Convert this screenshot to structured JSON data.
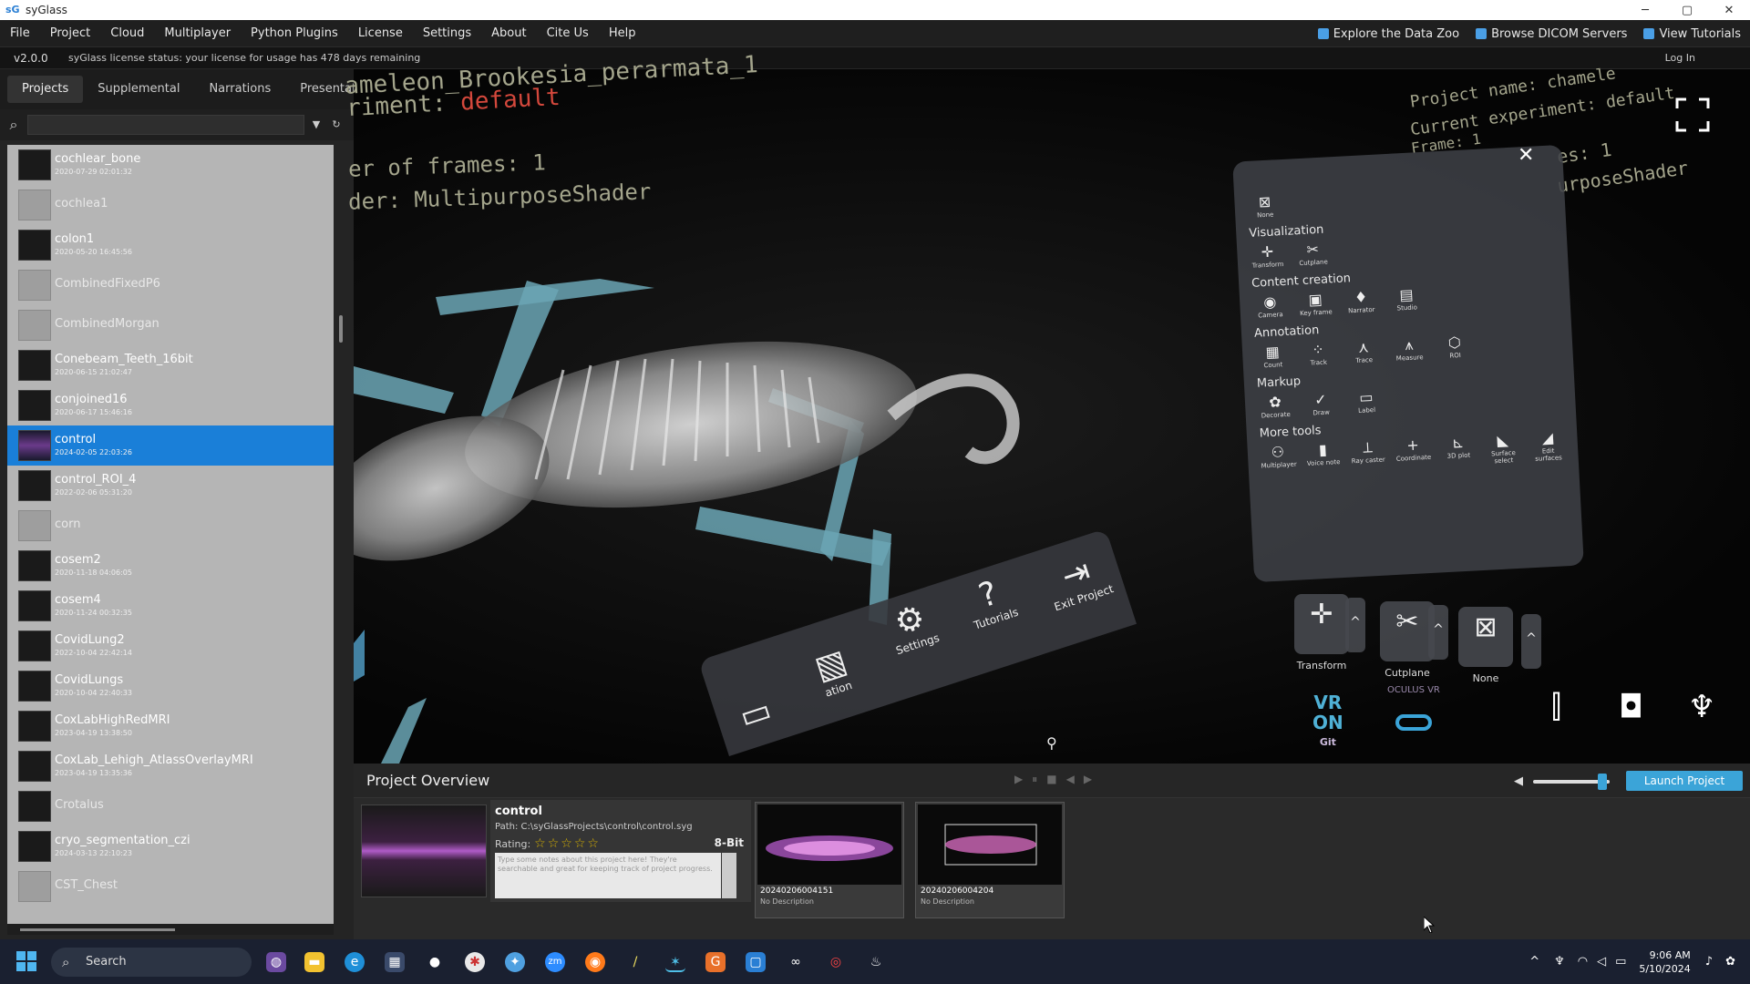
{
  "window": {
    "title": "syGlass",
    "logo": "sG",
    "minimize": "─",
    "maximize": "▢",
    "close": "✕"
  },
  "menu": {
    "items": [
      "File",
      "Project",
      "Cloud",
      "Multiplayer",
      "Python Plugins",
      "License",
      "Settings",
      "About",
      "Cite Us",
      "Help"
    ],
    "right": [
      "Explore the Data Zoo",
      "Browse DICOM Servers",
      "View Tutorials"
    ]
  },
  "status": {
    "version": "v2.0.0",
    "license": "syGlass license status: your license for usage has 478 days remaining",
    "login": "Log In"
  },
  "tabs": [
    "Projects",
    "Supplemental",
    "Narrations",
    "Presentations"
  ],
  "search": {
    "value": ""
  },
  "projects": [
    {
      "name": "cochlear_bone",
      "date": "2020-07-29 02:01:32",
      "dim": false
    },
    {
      "name": "cochlea1",
      "date": "",
      "dim": true
    },
    {
      "name": "colon1",
      "date": "2020-05-20 16:45:56",
      "dim": false
    },
    {
      "name": "CombinedFixedP6",
      "date": "",
      "dim": true
    },
    {
      "name": "CombinedMorgan",
      "date": "",
      "dim": true
    },
    {
      "name": "Conebeam_Teeth_16bit",
      "date": "2020-06-15 21:02:47",
      "dim": false
    },
    {
      "name": "conjoined16",
      "date": "2020-06-17 15:46:16",
      "dim": false
    },
    {
      "name": "control",
      "date": "2024-02-05 22:03:26",
      "dim": false,
      "selected": true
    },
    {
      "name": "control_ROI_4",
      "date": "2022-02-06 05:31:20",
      "dim": false
    },
    {
      "name": "corn",
      "date": "",
      "dim": true
    },
    {
      "name": "cosem2",
      "date": "2020-11-18 04:06:05",
      "dim": false
    },
    {
      "name": "cosem4",
      "date": "2020-11-24 00:32:35",
      "dim": false
    },
    {
      "name": "CovidLung2",
      "date": "2022-10-04 22:42:14",
      "dim": false
    },
    {
      "name": "CovidLungs",
      "date": "2020-10-04 22:40:33",
      "dim": false
    },
    {
      "name": "CoxLabHighRedMRI",
      "date": "2023-04-19 13:38:50",
      "dim": false
    },
    {
      "name": "CoxLab_Lehigh_AtlassOverlayMRI",
      "date": "2023-04-19 13:35:36",
      "dim": false
    },
    {
      "name": "Crotalus",
      "date": "",
      "dim": false
    },
    {
      "name": "cryo_segmentation_czi",
      "date": "2024-03-13 22:10:23",
      "dim": false
    },
    {
      "name": "CST_Chest",
      "date": "",
      "dim": true
    }
  ],
  "viewport": {
    "overlay_left": [
      "ameleon_Brookesia_perarmata_1",
      "riment: ",
      "er of frames: 1",
      "der: MultipurposeShader"
    ],
    "overlay_left_value": "default",
    "overlay_right": [
      "Project name: chamele",
      "Current experiment: ",
      "Frame: 1",
      "es: 1",
      "urposeShader"
    ],
    "overlay_right_value": "default"
  },
  "toolpanel": {
    "none": "None",
    "sections": [
      {
        "title": "Visualization",
        "tools": [
          {
            "icon": "✛",
            "label": "Transform"
          },
          {
            "icon": "✂",
            "label": "Cutplane"
          }
        ]
      },
      {
        "title": "Content creation",
        "tools": [
          {
            "icon": "◉",
            "label": "Camera"
          },
          {
            "icon": "▣",
            "label": "Key frame"
          },
          {
            "icon": "♦",
            "label": "Narrator"
          },
          {
            "icon": "▤",
            "label": "Studio"
          }
        ]
      },
      {
        "title": "Annotation",
        "tools": [
          {
            "icon": "▦",
            "label": "Count"
          },
          {
            "icon": "⁘",
            "label": "Track"
          },
          {
            "icon": "⋏",
            "label": "Trace"
          },
          {
            "icon": "⩚",
            "label": "Measure"
          },
          {
            "icon": "⬡",
            "label": "ROI"
          }
        ]
      },
      {
        "title": "Markup",
        "tools": [
          {
            "icon": "✿",
            "label": "Decorate"
          },
          {
            "icon": "✓",
            "label": "Draw"
          },
          {
            "icon": "▭",
            "label": "Label"
          }
        ]
      },
      {
        "title": "More tools",
        "tools": [
          {
            "icon": "⚇",
            "label": "Multiplayer"
          },
          {
            "icon": "▮",
            "label": "Voice note"
          },
          {
            "icon": "⟂",
            "label": "Ray caster"
          },
          {
            "icon": "+",
            "label": "Coordinate"
          },
          {
            "icon": "⊾",
            "label": "3D plot"
          },
          {
            "icon": "◣",
            "label": "Surface select"
          },
          {
            "icon": "◢",
            "label": "Edit surfaces"
          }
        ]
      }
    ]
  },
  "dock": [
    {
      "icon": "▭",
      "label": ""
    },
    {
      "icon": "▧",
      "label": "ation"
    },
    {
      "icon": "⚙",
      "label": "Settings"
    },
    {
      "icon": "?",
      "label": "Tutorials"
    },
    {
      "icon": "⇥",
      "label": "Exit Project"
    }
  ],
  "controls": [
    {
      "icon": "✛",
      "label": "Transform"
    },
    {
      "icon": "✂",
      "label": "Cutplane"
    },
    {
      "icon": "⊠",
      "label": "None"
    }
  ],
  "vr": {
    "line1": "VR",
    "line2": "ON",
    "sub": "Git",
    "oculus": "OCULUS VR"
  },
  "overview": {
    "title": "Project Overview",
    "media": [
      "▶",
      "⏸",
      "■",
      "◀",
      "▶"
    ],
    "launch": "Launch Project",
    "volume_level": 0.9,
    "project": {
      "name": "control",
      "path": "Path: C:\\syGlassProjects\\control\\control.syg",
      "rating_label": "Rating:",
      "stars": "☆☆☆☆☆",
      "bit": "8-Bit",
      "notes": "Type some notes about this project here! They're searchable and great for keeping track of project progress."
    },
    "snapshots": [
      {
        "name": "20240206004151",
        "desc": "No Description"
      },
      {
        "name": "20240206004204",
        "desc": "No Description"
      }
    ]
  },
  "taskbar": {
    "search": "Search",
    "time": "9:06 AM",
    "date": "5/10/2024"
  },
  "colors": {
    "accent": "#3ba4d8",
    "selection": "#1a7fd8",
    "overlay_text": "#a4a58c",
    "overlay_highlight": "#d4483c",
    "teal": "#6ba6b5"
  }
}
